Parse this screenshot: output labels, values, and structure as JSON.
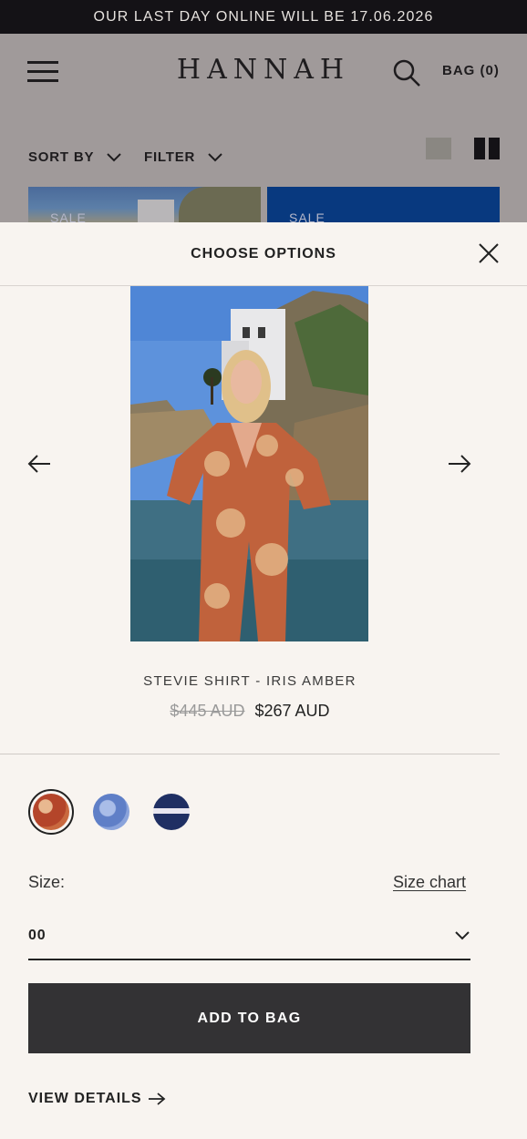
{
  "announcement": {
    "text": "OUR LAST DAY ONLINE WILL BE 17.06.2026"
  },
  "header": {
    "brand": "HANNAH",
    "bag_label": "BAG (0)"
  },
  "toolbar": {
    "sort_label": "SORT BY",
    "filter_label": "FILTER"
  },
  "grid": {
    "cards": [
      {
        "tag": "SALE"
      },
      {
        "tag": "SALE"
      }
    ]
  },
  "modal": {
    "title": "CHOOSE OPTIONS",
    "product": {
      "name": "STEVIE SHIRT - IRIS AMBER",
      "price_old": "$445 AUD",
      "price_new": "$267 AUD"
    },
    "swatches": [
      {
        "name": "iris-amber",
        "color": "#b4452a",
        "selected": true
      },
      {
        "name": "blue-print",
        "color": "#5f7fc7",
        "selected": false
      },
      {
        "name": "navy-print",
        "color": "#1f2f63",
        "selected": false
      }
    ],
    "size": {
      "label": "Size:",
      "chart_link": "Size chart",
      "value": "00"
    },
    "add_to_bag": "ADD TO BAG",
    "view_details": "VIEW DETAILS"
  },
  "colors": {
    "overlay": "#a09a9a",
    "modal_bg": "#f8f4f0",
    "button_bg": "#333234",
    "announce_bg": "#141216"
  }
}
